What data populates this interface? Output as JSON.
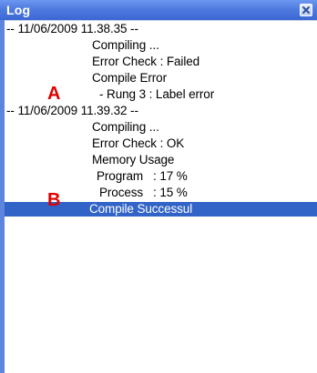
{
  "window": {
    "title": "Log",
    "close_icon": "close-icon"
  },
  "log": {
    "lines": [
      "-- 11/06/2009 11.38.35 --",
      "Compiling ...",
      "Error Check : Failed",
      "Compile Error",
      "- Rung 3 : Label error",
      "-- 11/06/2009 11.39.32 --",
      "Compiling ...",
      "Error Check : OK",
      "Memory Usage",
      "Program   : 17 %",
      "Process   : 15 %",
      "Compile Successul"
    ],
    "selected_index": 11
  },
  "markers": {
    "a": "A",
    "b": "B"
  },
  "colors": {
    "titlebar": "#4f7be0",
    "selection": "#3264c8",
    "marker": "#e00000"
  }
}
